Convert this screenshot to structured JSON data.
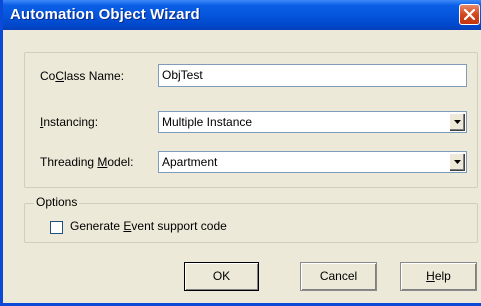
{
  "window": {
    "title": "Automation Object Wizard"
  },
  "fields": {
    "coclass": {
      "label_pre": "Co",
      "label_key": "C",
      "label_post": "lass Name:",
      "value": "ObjTest"
    },
    "instancing": {
      "label_pre": "",
      "label_key": "I",
      "label_post": "nstancing:",
      "value": "Multiple Instance"
    },
    "threading": {
      "label_pre": "Threading ",
      "label_key": "M",
      "label_post": "odel:",
      "value": "Apartment"
    }
  },
  "options": {
    "legend": "Options",
    "event_support": {
      "label_pre": "Generate ",
      "label_key": "E",
      "label_post": "vent support code",
      "checked": false
    }
  },
  "buttons": {
    "ok": "OK",
    "cancel": "Cancel",
    "help_key": "H",
    "help_post": "elp"
  },
  "icons": {
    "close": "close-icon",
    "dropdown": "chevron-down-icon"
  },
  "colors": {
    "titlebar": "#0452d8",
    "close_button": "#d3471c",
    "dialog_bg": "#ece9d8",
    "input_border": "#7f9db9"
  }
}
